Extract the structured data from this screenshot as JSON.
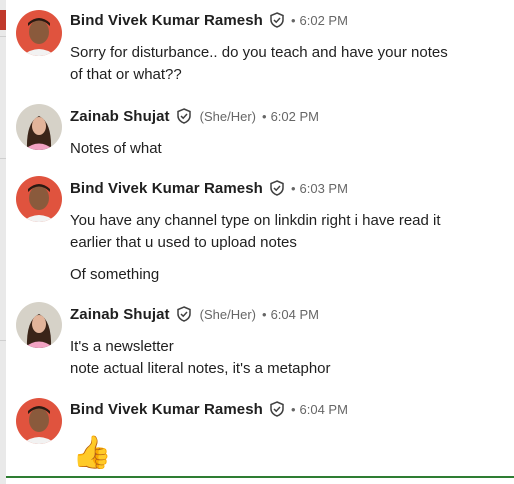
{
  "messages": [
    {
      "sender": "Bind Vivek Kumar Ramesh",
      "pronouns": "",
      "time": "6:02 PM",
      "lines": [
        "Sorry for disturbance.. do you teach and have your notes",
        "of that or what??"
      ]
    },
    {
      "sender": "Zainab Shujat",
      "pronouns": "(She/Her)",
      "time": "6:02 PM",
      "lines": [
        "Notes of what"
      ]
    },
    {
      "sender": "Bind Vivek Kumar Ramesh",
      "pronouns": "",
      "time": "6:03 PM",
      "lines": [
        "You have any channel type on linkdin right i have read it",
        "earlier that u used to upload notes",
        "Of something"
      ]
    },
    {
      "sender": "Zainab Shujat",
      "pronouns": "(She/Her)",
      "time": "6:04 PM",
      "lines": [
        "It's a newsletter",
        "note actual literal notes, it's a metaphor"
      ]
    },
    {
      "sender": "Bind Vivek Kumar Ramesh",
      "pronouns": "",
      "time": "6:04 PM",
      "lines": [],
      "emoji": "👍"
    }
  ],
  "separator": "•",
  "icons": {
    "verified": "verified-shield-icon"
  },
  "colors": {
    "accent_green": "#2e7d32",
    "meta_gray": "#666666"
  }
}
